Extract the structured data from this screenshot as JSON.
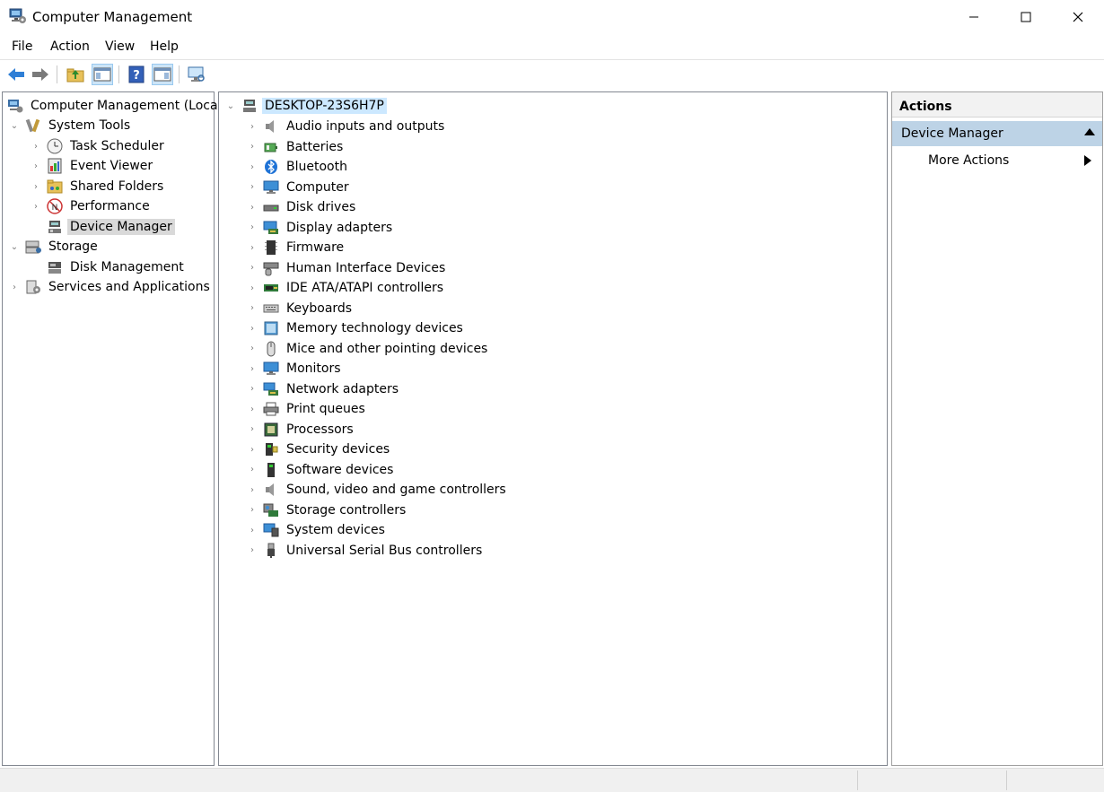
{
  "window": {
    "title": "Computer Management",
    "app_icon": "computer-management-icon"
  },
  "menu": {
    "items": [
      "File",
      "Action",
      "View",
      "Help"
    ]
  },
  "toolbar": {
    "buttons": [
      "back-icon",
      "forward-icon",
      "up-folder-icon",
      "show-hide-console-tree-icon",
      "help-icon",
      "show-hide-action-pane-icon",
      "computer-monitor-icon"
    ]
  },
  "left_tree": {
    "root": "Computer Management (Local)",
    "system_tools": "System Tools",
    "task_scheduler": "Task Scheduler",
    "event_viewer": "Event Viewer",
    "shared_folders": "Shared Folders",
    "performance": "Performance",
    "device_manager": "Device Manager",
    "storage": "Storage",
    "disk_management": "Disk Management",
    "services_apps": "Services and Applications"
  },
  "device_tree": {
    "root": "DESKTOP-23S6H7P",
    "categories": [
      {
        "label": "Audio inputs and outputs",
        "icon": "speaker-icon"
      },
      {
        "label": "Batteries",
        "icon": "battery-icon"
      },
      {
        "label": "Bluetooth",
        "icon": "bluetooth-icon"
      },
      {
        "label": "Computer",
        "icon": "monitor-icon"
      },
      {
        "label": "Disk drives",
        "icon": "disk-drive-icon"
      },
      {
        "label": "Display adapters",
        "icon": "display-adapter-icon"
      },
      {
        "label": "Firmware",
        "icon": "firmware-icon"
      },
      {
        "label": "Human Interface Devices",
        "icon": "hid-icon"
      },
      {
        "label": "IDE ATA/ATAPI controllers",
        "icon": "ide-controller-icon"
      },
      {
        "label": "Keyboards",
        "icon": "keyboard-icon"
      },
      {
        "label": "Memory technology devices",
        "icon": "memory-icon"
      },
      {
        "label": "Mice and other pointing devices",
        "icon": "mouse-icon"
      },
      {
        "label": "Monitors",
        "icon": "monitor-icon"
      },
      {
        "label": "Network adapters",
        "icon": "network-adapter-icon"
      },
      {
        "label": "Print queues",
        "icon": "printer-icon"
      },
      {
        "label": "Processors",
        "icon": "processor-icon"
      },
      {
        "label": "Security devices",
        "icon": "security-device-icon"
      },
      {
        "label": "Software devices",
        "icon": "software-device-icon"
      },
      {
        "label": "Sound, video and game controllers",
        "icon": "speaker-icon"
      },
      {
        "label": "Storage controllers",
        "icon": "storage-controller-icon"
      },
      {
        "label": "System devices",
        "icon": "system-devices-icon"
      },
      {
        "label": "Universal Serial Bus controllers",
        "icon": "usb-icon"
      }
    ]
  },
  "actions": {
    "header": "Actions",
    "section": "Device Manager",
    "more_actions": "More Actions"
  },
  "colors": {
    "selection": "#cce8ff",
    "actions_section": "#bdd3e6",
    "selected_gray": "#d9d9d9"
  }
}
